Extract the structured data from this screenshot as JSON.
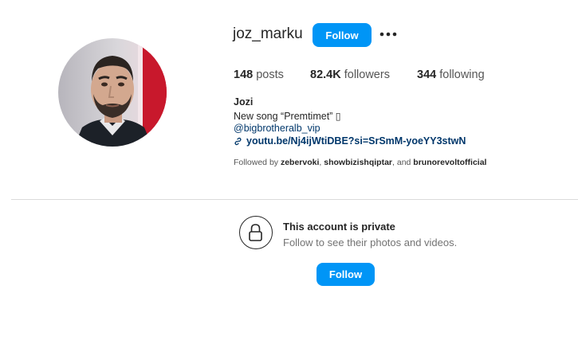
{
  "profile": {
    "username": "joz_marku",
    "follow_label": "Follow",
    "posts_count": "148",
    "posts_label": "posts",
    "followers_count": "82.4K",
    "followers_label": "followers",
    "following_count": "344",
    "following_label": "following",
    "full_name": "Jozi",
    "bio_line": "New song “Premtimet” ▯",
    "mention": "@bigbrotheralb_vip",
    "link": "youtu.be/Nj4ijWtiDBE?si=SrSmM-yoeYY3stwN",
    "followed_by_prefix": "Followed by ",
    "followed_by_user1": "zebervoki",
    "followed_by_sep1": ", ",
    "followed_by_user2": "showbizishqiptar",
    "followed_by_sep2": ", and ",
    "followed_by_user3": "brunorevoltofficial"
  },
  "private_notice": {
    "title": "This account is private",
    "subtitle": "Follow to see their photos and videos.",
    "follow_label": "Follow"
  },
  "icons": {
    "more": "more-horizontal-icon",
    "link": "link-icon",
    "lock": "lock-icon"
  },
  "colors": {
    "accent": "#0095f6",
    "link": "#00376b",
    "muted": "#737373"
  }
}
